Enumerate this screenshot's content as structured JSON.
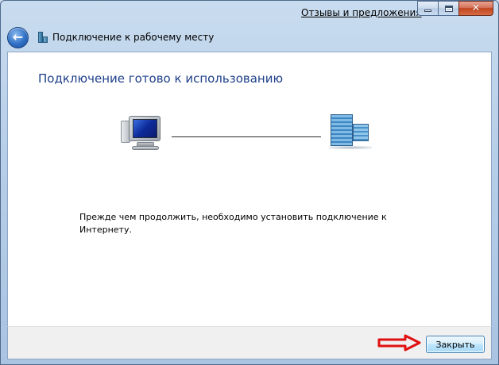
{
  "window": {
    "feedback_link": "Отзывы и предложения",
    "caption": {
      "minimize": "minimize-icon",
      "maximize": "maximize-icon",
      "close_glyph": "✕"
    }
  },
  "nav": {
    "back_icon": "back-arrow-icon",
    "back_glyph": "←",
    "wizard_icon": "workplace-connection-icon",
    "title": "Подключение к рабочему месту"
  },
  "content": {
    "heading": "Подключение готово к использованию",
    "illustration": {
      "left_icon": "computer-icon",
      "right_icon": "workplace-network-icon"
    },
    "message": "Прежде чем продолжить, необходимо установить подключение к Интернету."
  },
  "footer": {
    "annotation_icon": "red-arrow-icon",
    "close_label": "Закрыть"
  },
  "colors": {
    "heading": "#1e3f8a",
    "accent_arrow": "#e01010",
    "frame": "#b8cfe8"
  }
}
